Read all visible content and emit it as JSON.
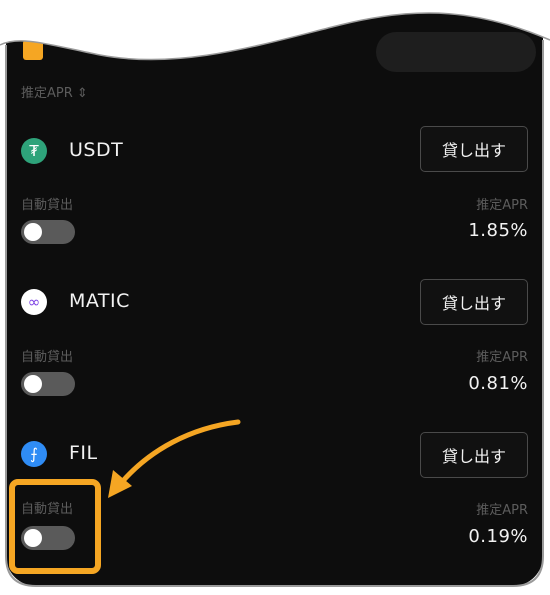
{
  "filters": {
    "sort_label": "推定APR ⇕"
  },
  "rows": [
    {
      "coin": "USDT",
      "lend_button": "貸し出す",
      "auto_lend_label": "自動貸出",
      "apr_label": "推定APR",
      "apr_value": "1.85%",
      "auto_lend_on": false,
      "icon_color": "#2ea37a",
      "icon_glyph": "₮"
    },
    {
      "coin": "MATIC",
      "lend_button": "貸し出す",
      "auto_lend_label": "自動貸出",
      "apr_label": "推定APR",
      "apr_value": "0.81%",
      "auto_lend_on": false,
      "icon_color": "#ffffff",
      "icon_glyph": "∞"
    },
    {
      "coin": "FIL",
      "lend_button": "貸し出す",
      "auto_lend_label": "自動貸出",
      "apr_label": "推定APR",
      "apr_value": "0.19%",
      "auto_lend_on": false,
      "icon_color": "#2f8cf5",
      "icon_glyph": "⨍"
    }
  ],
  "colors": {
    "accent": "#f5a623",
    "background": "#0d0d0d"
  }
}
